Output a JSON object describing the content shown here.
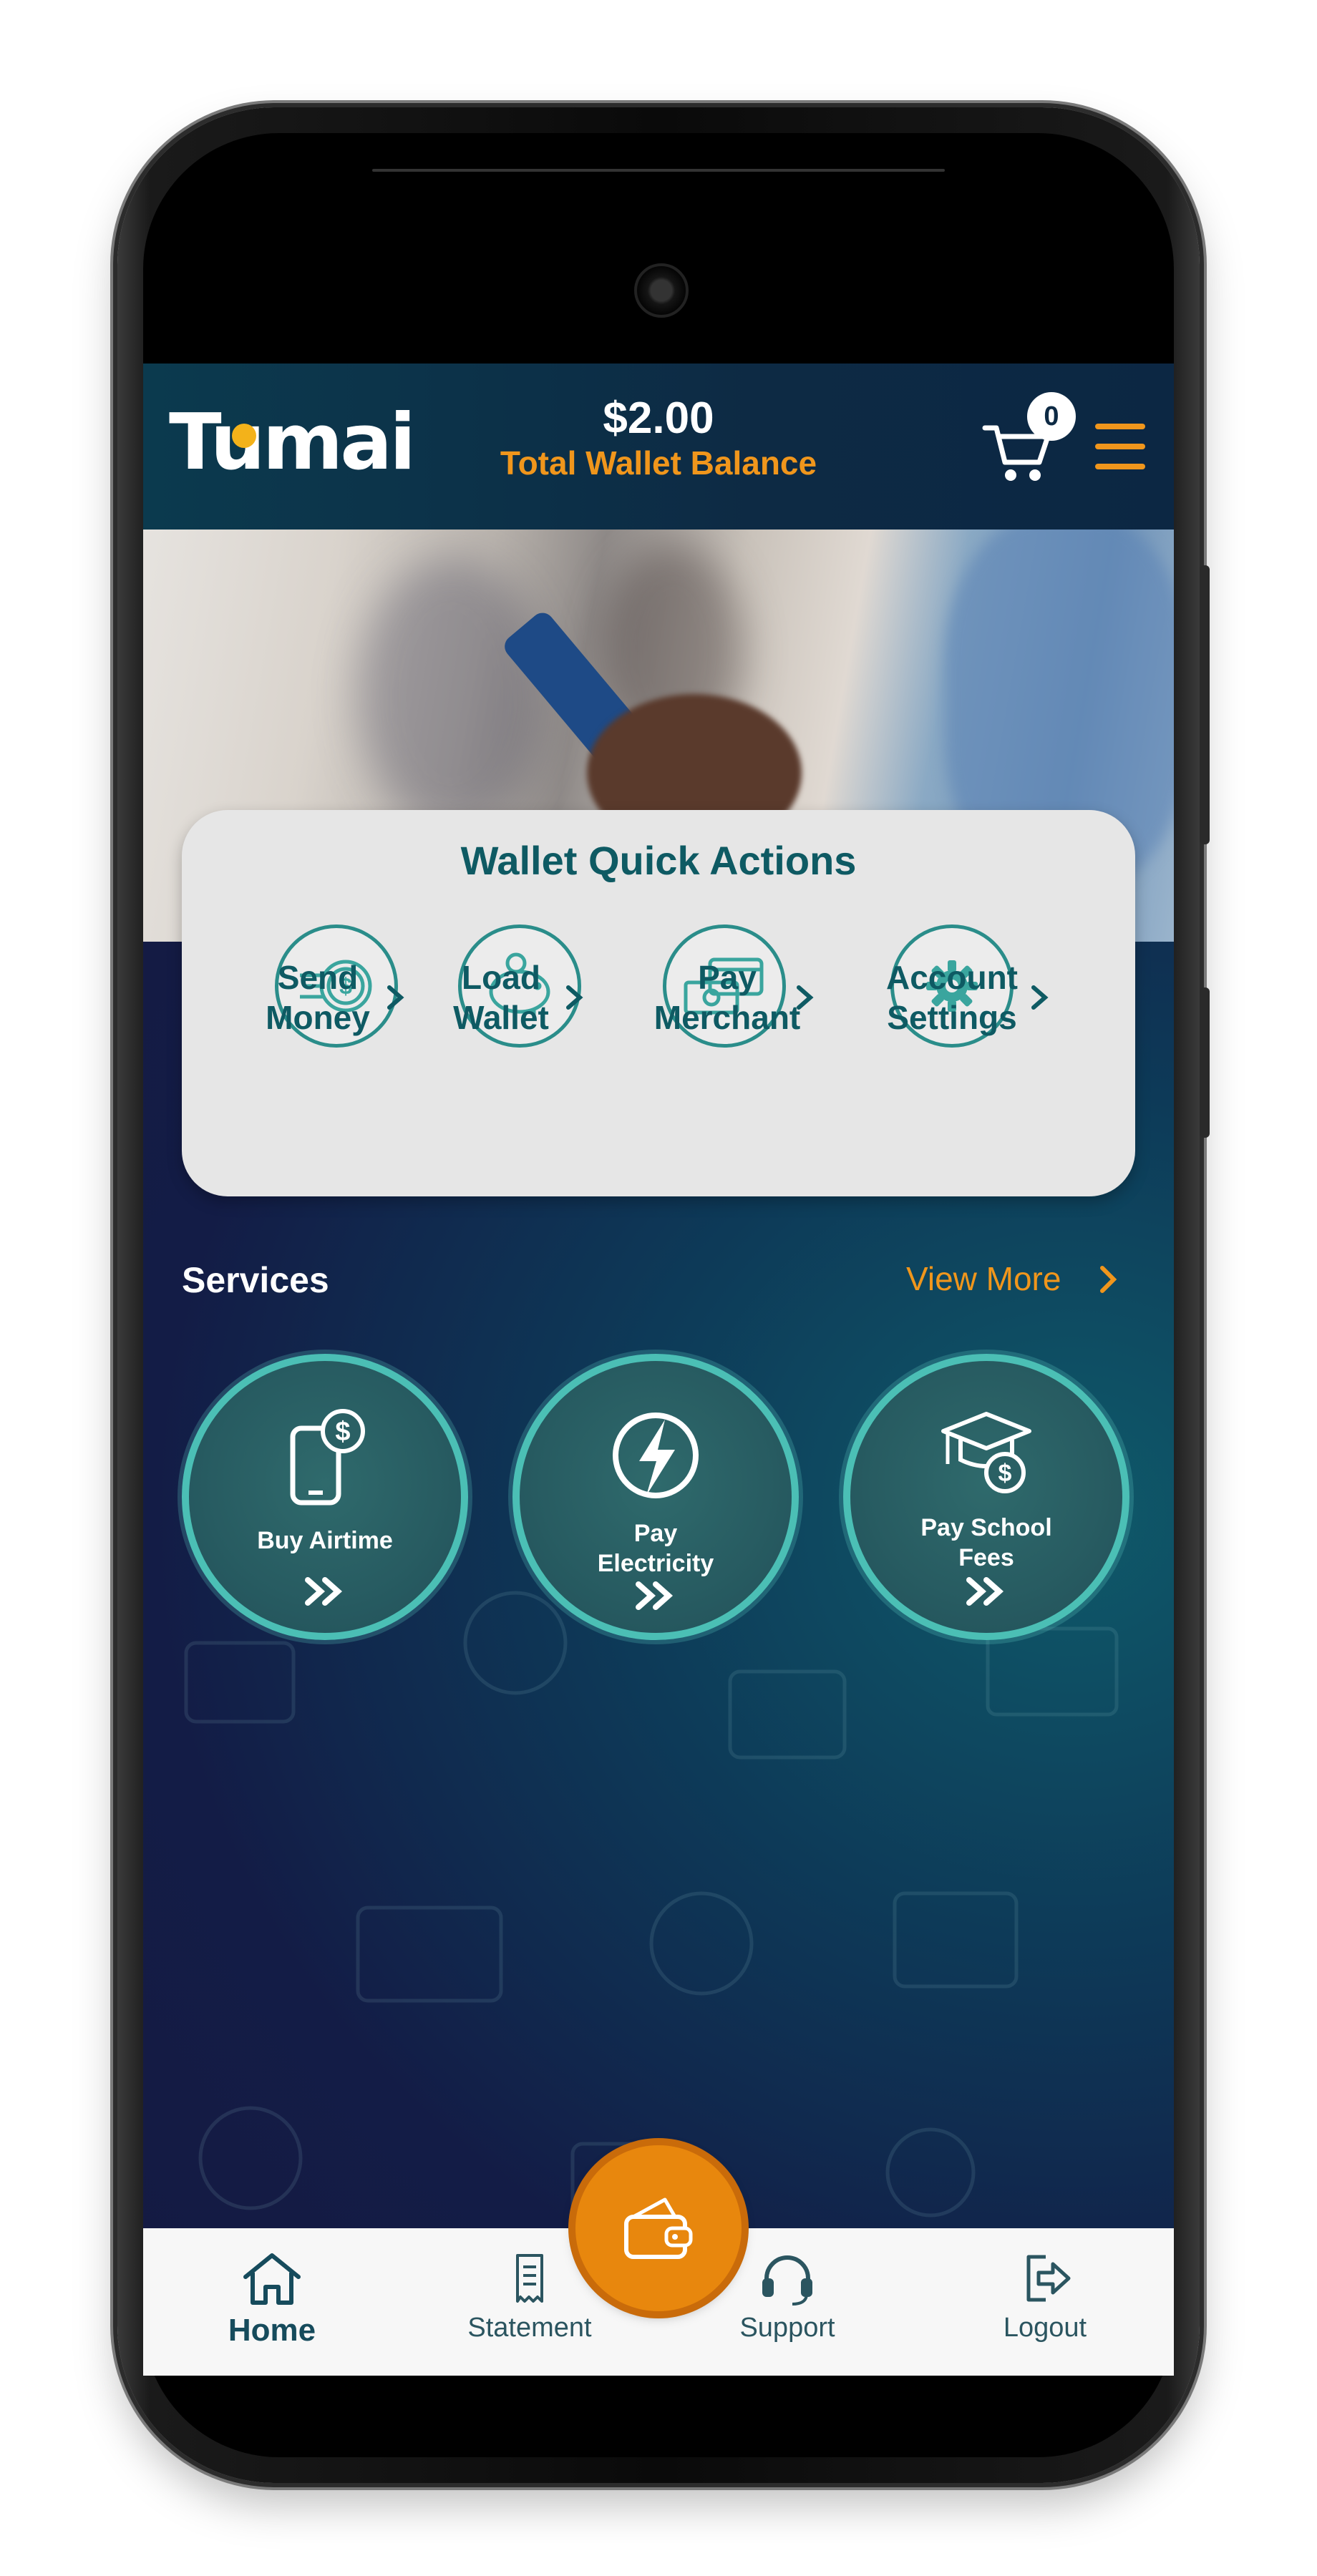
{
  "header": {
    "logo_text": "Tumai",
    "balance_amount": "$2.00",
    "balance_label": "Total Wallet Balance",
    "cart_count": "0"
  },
  "quick_actions": {
    "title": "Wallet Quick Actions",
    "items": [
      {
        "label_line1": "Send",
        "label_line2": "Money",
        "icon": "send-money-icon"
      },
      {
        "label_line1": "Load",
        "label_line2": "Wallet",
        "icon": "piggy-bank-icon"
      },
      {
        "label_line1": "Pay",
        "label_line2": "Merchant",
        "icon": "card-cash-icon"
      },
      {
        "label_line1": "Account",
        "label_line2": "Settings",
        "icon": "gear-icon"
      }
    ]
  },
  "services": {
    "title": "Services",
    "view_more": "View More",
    "items": [
      {
        "label_line1": "Buy Airtime",
        "label_line2": "",
        "icon": "phone-dollar-icon"
      },
      {
        "label_line1": "Pay",
        "label_line2": "Electricity",
        "icon": "lightning-icon"
      },
      {
        "label_line1": "Pay School",
        "label_line2": "Fees",
        "icon": "graduation-dollar-icon"
      }
    ]
  },
  "bottom_nav": {
    "items": [
      {
        "label": "Home",
        "icon": "home-icon",
        "active": true
      },
      {
        "label": "Statement",
        "icon": "receipt-icon",
        "active": false
      },
      {
        "label": "Support",
        "icon": "headset-icon",
        "active": false
      },
      {
        "label": "Logout",
        "icon": "logout-icon",
        "active": false
      }
    ],
    "center_button_icon": "wallet-icon"
  },
  "colors": {
    "accent_orange": "#f0961c",
    "teal_text": "#0e5a63",
    "header_bg": "#0d2a44"
  }
}
